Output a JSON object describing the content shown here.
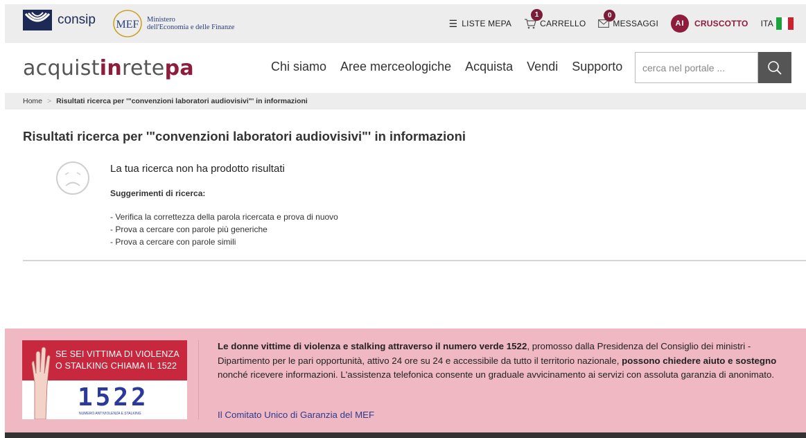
{
  "topbar": {
    "consip": "consip",
    "mef": "MEF",
    "mef_line1": "Ministero",
    "mef_line2": "dell'Economia e delle Finanze",
    "liste_mepa": "LISTE MEPA",
    "carrello": "CARRELLO",
    "carrello_count": "1",
    "messaggi": "MESSAGGI",
    "messaggi_count": "0",
    "avatar": "AI",
    "cruscotto": "CRUSCOTTO",
    "lang": "ITA"
  },
  "header": {
    "brand_a": "acquist",
    "brand_b": "in",
    "brand_c": "rete",
    "brand_d": "pa",
    "nav": [
      "Chi siamo",
      "Aree merceologiche",
      "Acquista",
      "Vendi",
      "Supporto"
    ],
    "search_placeholder": "cerca nel portale ..."
  },
  "breadcrumb": {
    "home": "Home",
    "current": "Risultati ricerca per '\"convenzioni laboratori audiovisivi\"' in informazioni"
  },
  "main": {
    "title": "Risultati ricerca per '\"convenzioni laboratori audiovisivi\"' in informazioni",
    "no_results": "La tua ricerca non ha prodotto risultati",
    "suggestions_title": "Suggerimenti di ricerca:",
    "suggestions": [
      "- Verifica la correttezza della parola ricercata e prova di nuovo",
      "- Prova a cercare con parole più generiche",
      "- Prova a cercare con parole simili"
    ]
  },
  "banner": {
    "promo_line1": "SE SEI VITTIMA DI VIOLENZA",
    "promo_line2": "O STALKING CHIAMA IL 1522",
    "promo_number": "1522",
    "promo_small": "NUMERO ANTIVIOLENZA E STALKING",
    "text_bold1": "Le donne vittime di violenza e stalking attraverso il numero verde 1522",
    "text_plain1": ", promosso dalla Presidenza del Consiglio dei ministri - Dipartimento per le pari opportunità, attivo 24 ore su 24 e accessibile da tutto il territorio nazionale, ",
    "text_bold2": "possono chiedere aiuto e sostegno",
    "text_plain2": " nonché ricevere informazioni. L'assistenza telefonica consente un graduale avvicinamento ai servizi con assoluta garanzia di anonimato.",
    "link": "Il Comitato Unico di Garanzia del MEF"
  },
  "colors": {
    "accent": "#8e1c3d",
    "banner_bg": "#f0b8c2",
    "topbar_bg": "#ededed"
  }
}
